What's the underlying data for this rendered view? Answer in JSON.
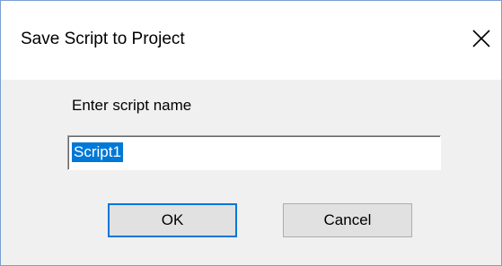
{
  "dialog": {
    "title": "Save Script to Project",
    "close_icon": "close-icon"
  },
  "form": {
    "prompt_label": "Enter script name",
    "script_name_value": "Script1"
  },
  "buttons": {
    "ok_label": "OK",
    "cancel_label": "Cancel"
  },
  "colors": {
    "selection": "#0078d7",
    "default_button_border": "#0078d7",
    "dialog_background": "#f0f0f0",
    "titlebar_background": "#ffffff"
  }
}
